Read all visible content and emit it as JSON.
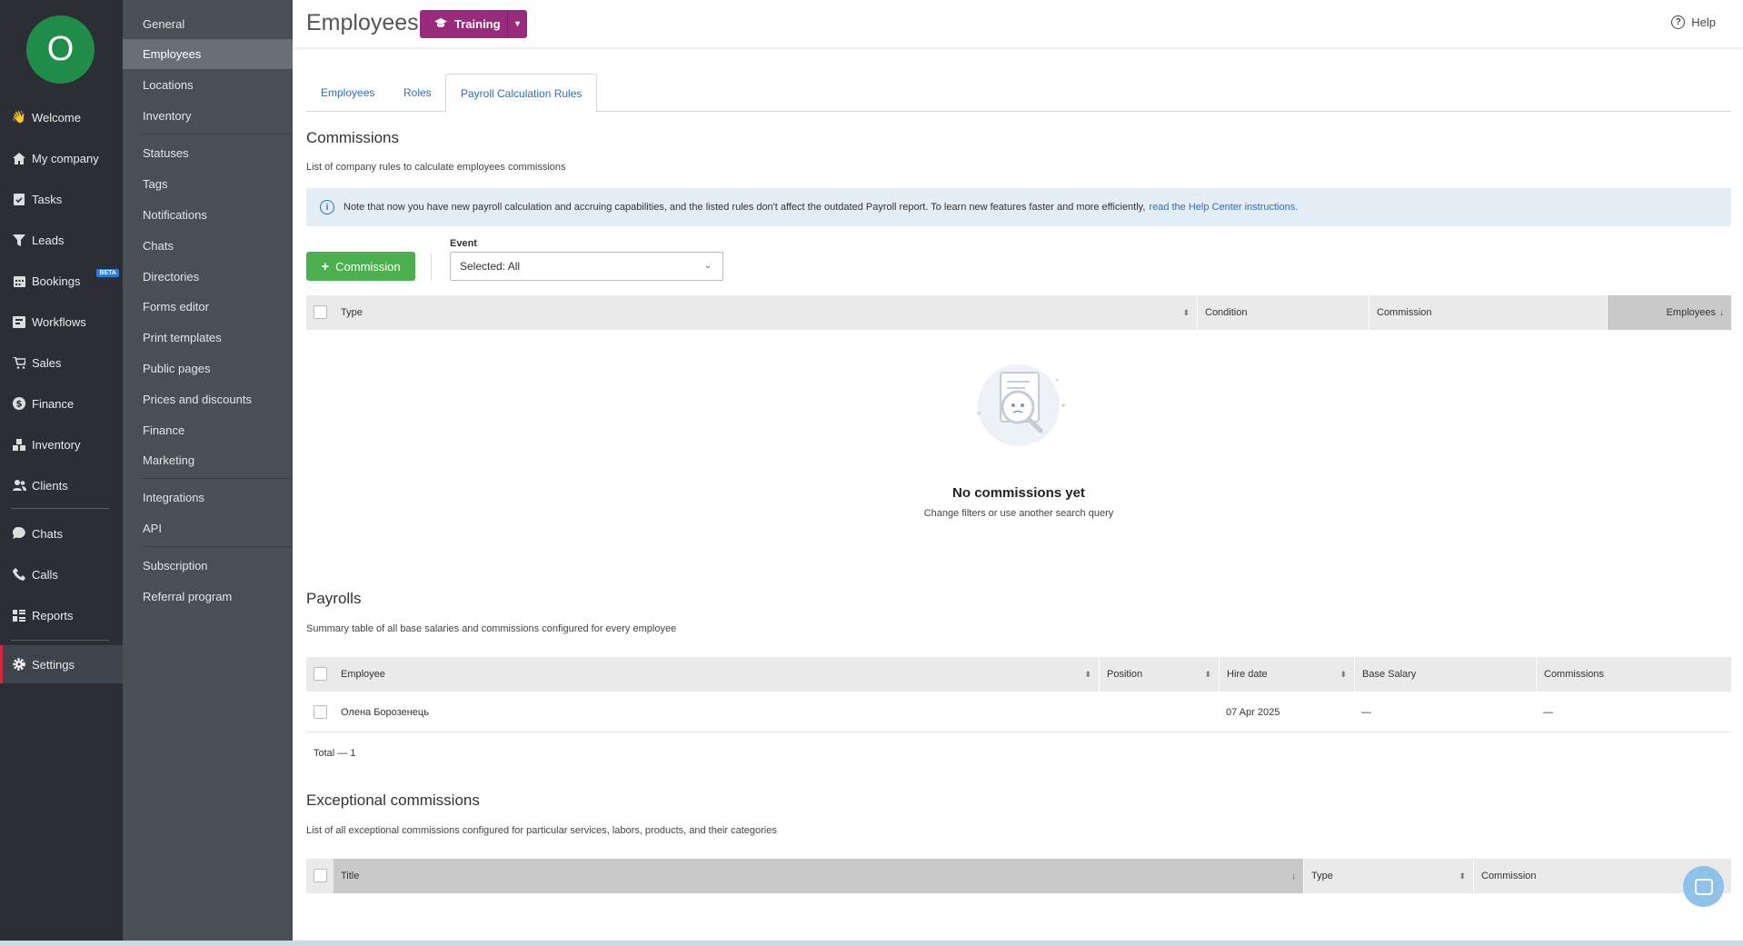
{
  "logo": {
    "letter": "O"
  },
  "nav": {
    "items": [
      {
        "label": "Welcome",
        "icon": "wave-hand-icon"
      },
      {
        "label": "My company",
        "icon": "home-icon"
      },
      {
        "label": "Tasks",
        "icon": "clipboard-check-icon"
      },
      {
        "label": "Leads",
        "icon": "funnel-icon"
      },
      {
        "label": "Bookings",
        "icon": "calendar-icon",
        "badge": "BETA"
      },
      {
        "label": "Workflows",
        "icon": "workflow-icon"
      },
      {
        "label": "Sales",
        "icon": "cart-icon"
      },
      {
        "label": "Finance",
        "icon": "dollar-icon"
      },
      {
        "label": "Inventory",
        "icon": "boxes-icon"
      },
      {
        "label": "Clients",
        "icon": "users-icon"
      },
      {
        "label": "Chats",
        "icon": "chat-icon"
      },
      {
        "label": "Calls",
        "icon": "phone-icon"
      },
      {
        "label": "Reports",
        "icon": "reports-icon"
      },
      {
        "label": "Settings",
        "icon": "gear-icon"
      }
    ]
  },
  "subnav": {
    "items": [
      "General",
      "Employees",
      "Locations",
      "Inventory",
      "Statuses",
      "Tags",
      "Notifications",
      "Chats",
      "Directories",
      "Forms editor",
      "Print templates",
      "Public pages",
      "Prices and discounts",
      "Finance",
      "Marketing",
      "Integrations",
      "API",
      "Subscription",
      "Referral program"
    ],
    "active": "Employees"
  },
  "header": {
    "title": "Employees",
    "training_label": "Training",
    "help_label": "Help"
  },
  "tabs": [
    "Employees",
    "Roles",
    "Payroll Calculation Rules"
  ],
  "commissions": {
    "title": "Commissions",
    "subtitle": "List of company rules to calculate employees commissions",
    "notice_text": "Note that now you have new payroll calculation and accruing capabilities, and the listed rules don't affect the outdated Payroll report. To learn new features faster and more efficiently,",
    "notice_link": "read the Help Center instructions.",
    "add_button": "Commission",
    "event_label": "Event",
    "event_value": "Selected: All",
    "columns": [
      "Type",
      "Condition",
      "Commission",
      "Employees"
    ],
    "empty_title": "No commissions yet",
    "empty_sub": "Change filters or use another search query"
  },
  "payrolls": {
    "title": "Payrolls",
    "subtitle": "Summary table of all base salaries and commissions configured for every employee",
    "columns": [
      "Employee",
      "Position",
      "Hire date",
      "Base Salary",
      "Commissions"
    ],
    "rows": [
      {
        "employee": "Олена Борозенець",
        "position": "",
        "hire_date": "07 Apr 2025",
        "base_salary": "—",
        "commissions": "—"
      }
    ],
    "total": "Total — 1"
  },
  "exceptional": {
    "title": "Exceptional commissions",
    "subtitle": "List of all exceptional commissions configured for particular services, labors, products, and their categories",
    "columns": [
      "Title",
      "Type",
      "Commission"
    ]
  }
}
